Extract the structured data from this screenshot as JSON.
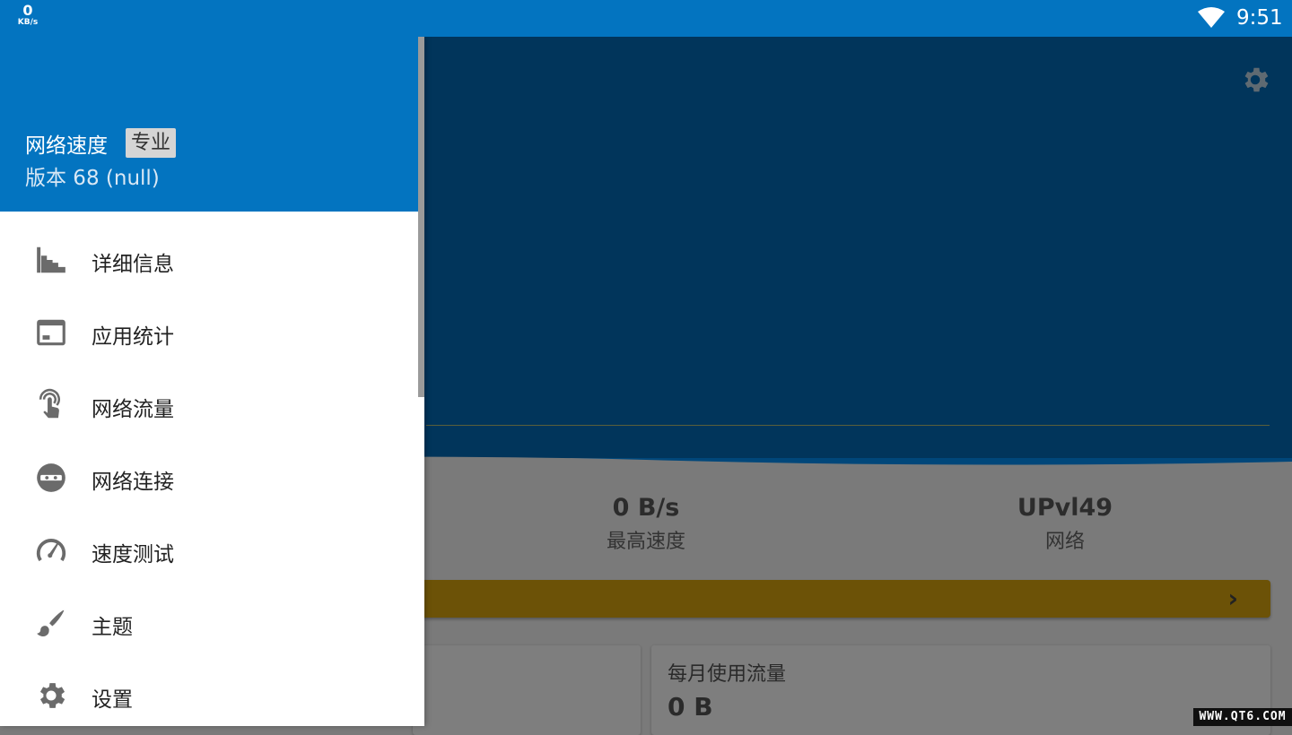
{
  "status_bar": {
    "net_speed_value": "0",
    "net_speed_unit": "KB/s",
    "time": "9:51"
  },
  "drawer": {
    "app_name": "网络速度",
    "badge": "专业",
    "version": "版本 68 (null)",
    "items": [
      {
        "label": "详细信息",
        "icon": "bar-chart-icon"
      },
      {
        "label": "应用统计",
        "icon": "app-window-icon"
      },
      {
        "label": "网络流量",
        "icon": "touch-icon"
      },
      {
        "label": "网络连接",
        "icon": "incognito-icon"
      },
      {
        "label": "速度测试",
        "icon": "speedometer-icon"
      },
      {
        "label": "主题",
        "icon": "brush-icon"
      },
      {
        "label": "设置",
        "icon": "gear-icon"
      }
    ]
  },
  "main": {
    "stats": [
      {
        "value": "0 B/s",
        "label": "最高速度"
      },
      {
        "value": "UPvl49",
        "label": "网络"
      }
    ],
    "cards": [
      {
        "title": "",
        "value": ""
      },
      {
        "title": "每月使用流量",
        "value": "0 B"
      }
    ]
  },
  "watermark": "WWW.QT6.COM",
  "colors": {
    "primary": "#0374c0",
    "hero": "#01355b",
    "accent_bar": "#6c5207"
  }
}
